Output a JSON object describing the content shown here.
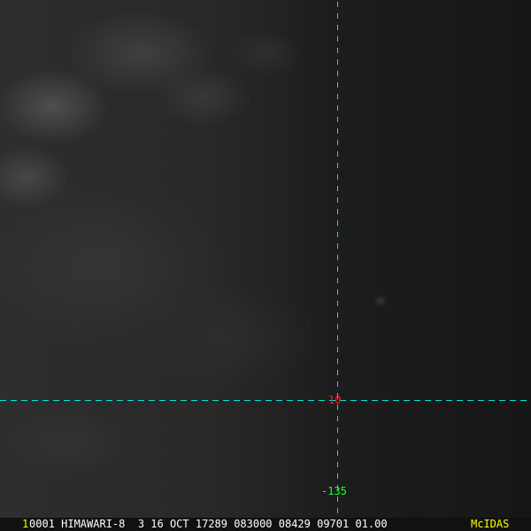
{
  "image": {
    "description_free": true
  },
  "overlay": {
    "latitude_label": "10",
    "longitude_label": "-135",
    "grid_color": "#00e5e5",
    "lat_label_color": "#ff2020",
    "lon_label_color": "#20ff20"
  },
  "status_bar": {
    "frame_number": "1",
    "info": "0001 HIMAWARI-8  3 16 OCT 17289 083000 08429 09701 01.00",
    "logo": "McIDAS"
  }
}
